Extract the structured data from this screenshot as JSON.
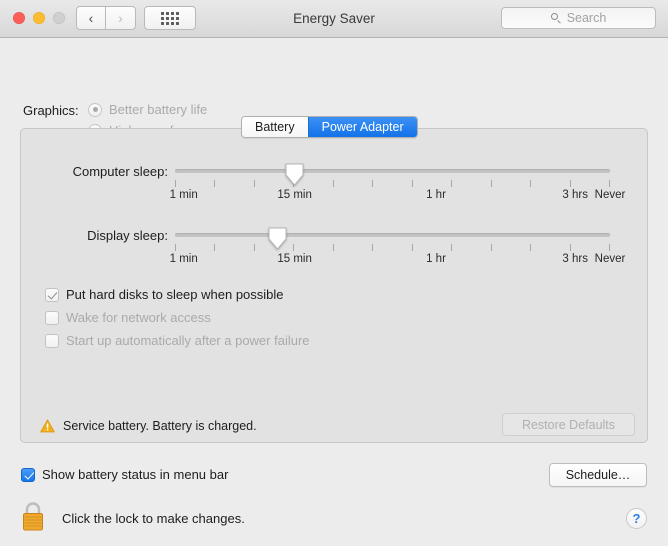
{
  "window": {
    "title": "Energy Saver",
    "traffic_lights": [
      "close",
      "minimize",
      "zoom"
    ],
    "nav_back": "‹",
    "nav_forward": "›",
    "grid_icon": "show-all-icon",
    "search": {
      "placeholder": "Search",
      "icon": "search-icon",
      "value": ""
    }
  },
  "graphics": {
    "label": "Graphics:",
    "options": [
      {
        "label": "Better battery life",
        "selected": true,
        "enabled": false
      },
      {
        "label": "Higher performance",
        "selected": false,
        "enabled": false
      }
    ]
  },
  "tabs": [
    {
      "label": "Battery",
      "active": false
    },
    {
      "label": "Power Adapter",
      "active": true
    }
  ],
  "sliders": [
    {
      "label": "Computer sleep:",
      "value_label": "15 min",
      "thumb_percent": 27.5,
      "tick_count": 12,
      "tick_labels": [
        {
          "text": "1 min",
          "percent": 2
        },
        {
          "text": "15 min",
          "percent": 27.5
        },
        {
          "text": "1 hr",
          "percent": 60
        },
        {
          "text": "3 hrs",
          "percent": 92
        },
        {
          "text": "Never",
          "percent": 100
        }
      ]
    },
    {
      "label": "Display sleep:",
      "value_label": "15 min",
      "thumb_percent": 23.5,
      "tick_count": 12,
      "tick_labels": [
        {
          "text": "1 min",
          "percent": 2
        },
        {
          "text": "15 min",
          "percent": 27.5
        },
        {
          "text": "1 hr",
          "percent": 60
        },
        {
          "text": "3 hrs",
          "percent": 92
        },
        {
          "text": "Never",
          "percent": 100
        }
      ]
    }
  ],
  "checkboxes": [
    {
      "label": "Put hard disks to sleep when possible",
      "checked": true,
      "enabled": false
    },
    {
      "label": "Wake for network access",
      "checked": false,
      "enabled": false
    },
    {
      "label": "Start up automatically after a power failure",
      "checked": false,
      "enabled": false
    }
  ],
  "status": {
    "icon": "warning-triangle-icon",
    "text": "Service battery. Battery is charged."
  },
  "buttons": {
    "restore_defaults": "Restore Defaults",
    "schedule": "Schedule…",
    "help": "?"
  },
  "menu_bar_option": {
    "label": "Show battery status in menu bar",
    "checked": true
  },
  "lock": {
    "icon": "lock-closed-icon",
    "text": "Click the lock to make changes."
  },
  "colors": {
    "accent_blue": "#1577ec",
    "warning_yellow": "#f2b01e",
    "lock_gold": "#f0a92e",
    "window_bg": "#ececec",
    "content_bg": "#e2e2e2",
    "help_blue": "#2f7fe8"
  }
}
